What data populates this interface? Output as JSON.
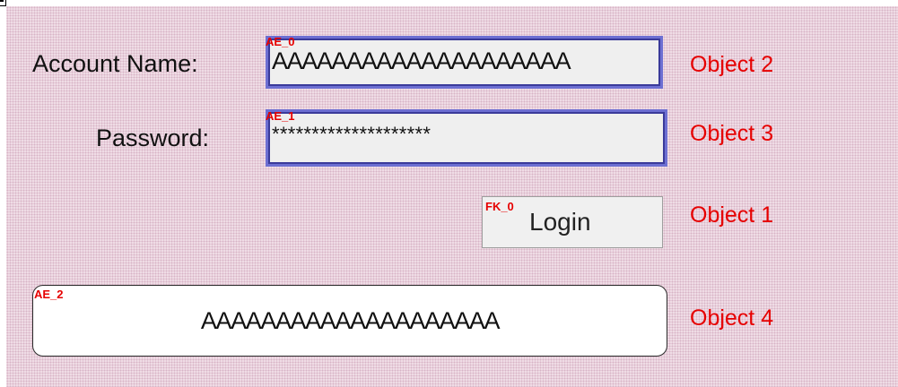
{
  "form": {
    "account_label": "Account Name:",
    "password_label": "Password:",
    "account_value": "AAAAAAAAAAAAAAAAAAAA",
    "password_value": "********************",
    "login_label": "Login",
    "output_value": "AAAAAAAAAAAAAAAAAAAA"
  },
  "tags": {
    "account": "AE_0",
    "password": "AE_1",
    "login": "FK_0",
    "output": "AE_2"
  },
  "objects": {
    "account": "Object 2",
    "password": "Object 3",
    "login": "Object 1",
    "output": "Object 4"
  },
  "colors": {
    "background": "#f0dde6",
    "annotation": "#e60000",
    "field_border": "#6d6fd2",
    "field_fill": "#efefef"
  }
}
